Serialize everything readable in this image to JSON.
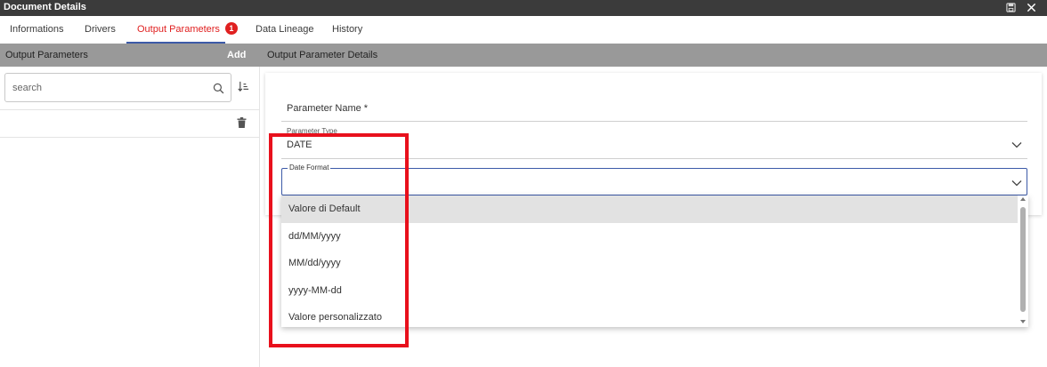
{
  "window": {
    "title": "Document Details",
    "icons": [
      "save-icon",
      "close-icon"
    ]
  },
  "tabs": [
    {
      "label": "Informations"
    },
    {
      "label": "Drivers"
    },
    {
      "label": "Output Parameters",
      "badge": "1",
      "active": true
    },
    {
      "label": "Data Lineage"
    },
    {
      "label": "History"
    }
  ],
  "left_panel": {
    "header": "Output Parameters",
    "add_label": "Add",
    "search": {
      "placeholder": "search",
      "value": ""
    }
  },
  "right_panel": {
    "header": "Output Parameter Details",
    "parameter_name_label": "Parameter Name *",
    "parameter_type_label": "Parameter Type",
    "parameter_type_value": "DATE",
    "date_format_label": "Date Format",
    "date_format_value": ""
  },
  "dropdown": {
    "options": [
      "Valore di Default",
      "dd/MM/yyyy",
      "MM/dd/yyyy",
      "yyyy-MM-dd",
      "Valore personalizzato"
    ],
    "highlighted": "Valore di Default"
  },
  "colors": {
    "accent": "#e02020",
    "focus": "#3c5aa8",
    "annotation": "#e8101c",
    "header_bar": "#999999",
    "title_bar": "#3b3b3b"
  }
}
